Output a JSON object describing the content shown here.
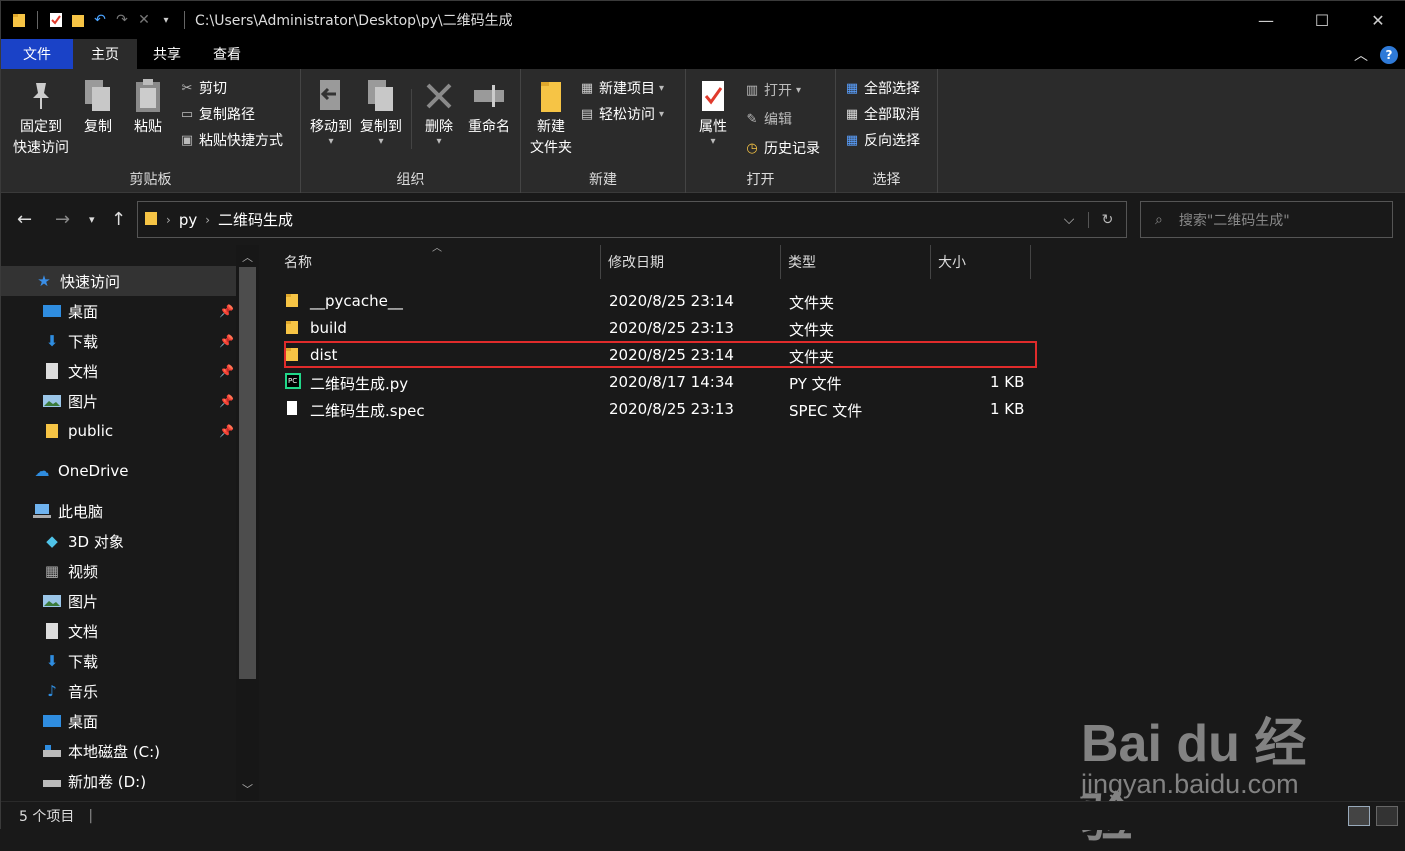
{
  "titlebar": {
    "path": "C:\\Users\\Administrator\\Desktop\\py\\二维码生成",
    "quick_access_icons": [
      "folder-icon",
      "properties-icon",
      "new-folder-icon",
      "undo-icon",
      "redo-icon",
      "delete-icon",
      "customize-dropdown-icon"
    ]
  },
  "tabs": [
    "文件",
    "主页",
    "共享",
    "查看"
  ],
  "ribbon": {
    "clipboard": {
      "label": "剪贴板",
      "pin_line1": "固定到",
      "pin_line2": "快速访问",
      "copy": "复制",
      "paste": "粘贴",
      "cut": "剪切",
      "copy_path": "复制路径",
      "paste_shortcut": "粘贴快捷方式"
    },
    "organize": {
      "label": "组织",
      "move_to": "移动到",
      "copy_to": "复制到",
      "delete": "删除",
      "rename": "重命名"
    },
    "new": {
      "label": "新建",
      "new_folder_line1": "新建",
      "new_folder_line2": "文件夹",
      "new_item": "新建项目",
      "easy_access": "轻松访问"
    },
    "open": {
      "label": "打开",
      "properties": "属性",
      "open": "打开",
      "edit": "编辑",
      "history": "历史记录"
    },
    "select": {
      "label": "选择",
      "select_all": "全部选择",
      "select_none": "全部取消",
      "invert": "反向选择"
    }
  },
  "address": {
    "crumbs": [
      "py",
      "二维码生成"
    ],
    "search_placeholder": "搜索\"二维码生成\""
  },
  "nav": {
    "quick_access": "快速访问",
    "qa_items": [
      {
        "label": "桌面",
        "icon": "desktop-icon"
      },
      {
        "label": "下载",
        "icon": "download-icon"
      },
      {
        "label": "文档",
        "icon": "document-icon"
      },
      {
        "label": "图片",
        "icon": "pictures-icon"
      },
      {
        "label": "public",
        "icon": "folder-user-icon"
      }
    ],
    "onedrive": "OneDrive",
    "this_pc": "此电脑",
    "pc_items": [
      {
        "label": "3D 对象",
        "icon": "3d-objects-icon"
      },
      {
        "label": "视频",
        "icon": "video-icon"
      },
      {
        "label": "图片",
        "icon": "pictures-icon"
      },
      {
        "label": "文档",
        "icon": "document-icon"
      },
      {
        "label": "下载",
        "icon": "download-icon"
      },
      {
        "label": "音乐",
        "icon": "music-icon"
      },
      {
        "label": "桌面",
        "icon": "desktop-icon"
      },
      {
        "label": "本地磁盘 (C:)",
        "icon": "drive-c-icon"
      },
      {
        "label": "新加卷 (D:)",
        "icon": "drive-d-icon"
      }
    ]
  },
  "columns": {
    "name": "名称",
    "date": "修改日期",
    "type": "类型",
    "size": "大小"
  },
  "files": [
    {
      "name": "__pycache__",
      "date": "2020/8/25 23:14",
      "type": "文件夹",
      "size": "",
      "icon": "folder-icon"
    },
    {
      "name": "build",
      "date": "2020/8/25 23:13",
      "type": "文件夹",
      "size": "",
      "icon": "folder-icon"
    },
    {
      "name": "dist",
      "date": "2020/8/25 23:14",
      "type": "文件夹",
      "size": "",
      "icon": "folder-icon"
    },
    {
      "name": "二维码生成.py",
      "date": "2020/8/17 14:34",
      "type": "PY 文件",
      "size": "1 KB",
      "icon": "pycharm-file-icon"
    },
    {
      "name": "二维码生成.spec",
      "date": "2020/8/25 23:13",
      "type": "SPEC 文件",
      "size": "1 KB",
      "icon": "blank-file-icon"
    }
  ],
  "highlighted_row": "dist",
  "highlight_color": "#e02b2b",
  "status": {
    "count": "5 个项目"
  },
  "watermark": {
    "brand": "Bai du 经验",
    "url": "jingyan.baidu.com"
  }
}
